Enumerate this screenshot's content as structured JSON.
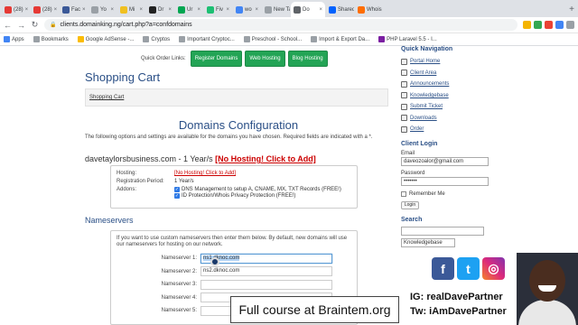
{
  "browser": {
    "tabs": [
      {
        "label": "(28)",
        "color": "#e53935"
      },
      {
        "label": "(28)",
        "color": "#e53935"
      },
      {
        "label": "Fac",
        "color": "#3b5998"
      },
      {
        "label": "Yo",
        "color": "#9aa0a6"
      },
      {
        "label": "Mi",
        "color": "#f0c020"
      },
      {
        "label": "Dr",
        "color": "#222222"
      },
      {
        "label": "Ur",
        "color": "#00a651"
      },
      {
        "label": "Fiv",
        "color": "#1dbf73"
      },
      {
        "label": "wo",
        "color": "#4285f4"
      },
      {
        "label": "New Ta",
        "color": "#9aa0a6"
      },
      {
        "label": "Do",
        "color": "#5f6368"
      },
      {
        "label": "Shared",
        "color": "#0061fe"
      },
      {
        "label": "Whois",
        "color": "#ff6d00"
      }
    ],
    "active_tab_index": 10,
    "url": "clients.domainking.ng/cart.php?a=confdomains",
    "bookmarks": [
      {
        "label": "Apps",
        "color": "#4285f4"
      },
      {
        "label": "Bookmarks",
        "color": "#9aa0a6"
      },
      {
        "label": "Google AdSense -...",
        "color": "#fbbc05"
      },
      {
        "label": "Cryptos",
        "color": "#9aa0a6"
      },
      {
        "label": "Important Cryptoc...",
        "color": "#9aa0a6"
      },
      {
        "label": "Preschool - School...",
        "color": "#9aa0a6"
      },
      {
        "label": "Import & Export Da...",
        "color": "#9aa0a6"
      },
      {
        "label": "PHP Laravel 5.5 - I...",
        "color": "#7b1fa2"
      }
    ]
  },
  "page": {
    "quick_order_label": "Quick Order Links:",
    "quick_links": [
      "Register Domains",
      "Web Hosting",
      "Blog Hosting"
    ],
    "title": "Shopping Cart",
    "breadcrumb": "Shopping Cart",
    "heading": "Domains Configuration",
    "intro": "The following options and settings are available for the domains you have chosen. Required fields are indicated with a *.",
    "domain_name": "davetaylorsbusiness.com - 1 Year/s",
    "domain_warning": "[No Hosting! Click to Add]",
    "config": {
      "hosting_label": "Hosting:",
      "hosting_value": "[No Hosting! Click to Add]",
      "period_label": "Registration Period:",
      "period_value": "1 Year/s",
      "addons_label": "Addons:",
      "addons": [
        "DNS Management to setup A, CNAME, MX, TXT Records (FREE!)",
        "ID Protection/Whois Privacy Protection (FREE!)"
      ]
    },
    "nameservers_title": "Nameservers",
    "nameservers_intro": "If you want to use custom nameservers then enter them below. By default, new domains will use our nameservers for hosting on our network.",
    "nameservers": [
      {
        "label": "Nameserver 1:",
        "value": "ns1.dknoc.com"
      },
      {
        "label": "Nameserver 2:",
        "value": "ns2.dknoc.com"
      },
      {
        "label": "Nameserver 3:",
        "value": ""
      },
      {
        "label": "Nameserver 4:",
        "value": ""
      },
      {
        "label": "Nameserver 5:",
        "value": ""
      }
    ]
  },
  "sidebar": {
    "quick_nav_title": "Quick Navigation",
    "nav_items": [
      "Portal Home",
      "Client Area",
      "Announcements",
      "Knowledgebase",
      "Submit Ticket",
      "Downloads",
      "Order"
    ],
    "login_title": "Client Login",
    "email_label": "Email",
    "email_value": "daveozoalor@gmail.com",
    "password_label": "Password",
    "password_value": "•••••••",
    "remember_label": "Remember Me",
    "login_button": "Login",
    "search_title": "Search",
    "search_select": "Knowledgebase"
  },
  "overlay": {
    "course_text": "Full course at Braintem.org",
    "ig_handle": "IG: realDavePartner",
    "tw_handle": "Tw: iAmDavePartner",
    "social_icons": [
      "facebook-icon",
      "twitter-icon",
      "instagram-icon"
    ]
  }
}
